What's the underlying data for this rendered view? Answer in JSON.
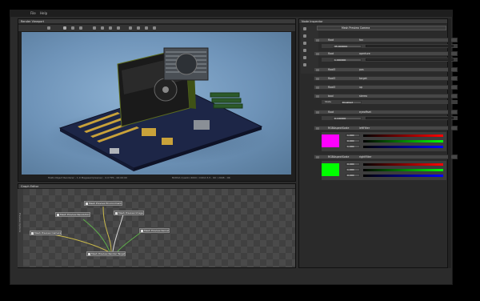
{
  "menu": {
    "file": "File",
    "help": "Help"
  },
  "viewport": {
    "title": "Render Viewport",
    "status_left": "Multi-Object Renderer  -  1.0  Megasamples/sec  -  0.0 FPS  -  00:00:00",
    "status_right": "NVIDIA Quadro 6000 / CUDA 5.5  -  60 / 2048  -  OK"
  },
  "inspector": {
    "title": "Node Inspector",
    "header_value": "Mesh Preview Camera",
    "rows": [
      {
        "type": "float",
        "name": "fov",
        "value": "35.000000"
      },
      {
        "type": "float",
        "name": "aperture",
        "value": "1.000000"
      },
      {
        "type": "float3",
        "name": "pos"
      },
      {
        "type": "float3",
        "name": "target"
      },
      {
        "type": "float3",
        "name": "up"
      },
      {
        "type": "bool",
        "name": "stereo",
        "state_label": "State",
        "state_value": "Disabled"
      },
      {
        "type": "float",
        "name": "eyeoffset",
        "value": "0.100000"
      }
    ],
    "colors": [
      {
        "type": "RGBAspectScale",
        "name": "leftFilter",
        "hex": "#ff00ff",
        "r": "1.000",
        "g": "0.000",
        "b": "1.000"
      },
      {
        "type": "RGBAspectScale",
        "name": "rightFilter",
        "hex": "#00ff00",
        "r": "0.000",
        "g": "1.000",
        "b": "0.000"
      }
    ]
  },
  "graph": {
    "title": "Graph Editor",
    "side_label": "Preview Options",
    "nodes": [
      {
        "id": "env",
        "label": "Mesh Preview Environment"
      },
      {
        "id": "mat",
        "label": "Mesh Preview Resolution"
      },
      {
        "id": "img",
        "label": "Mesh Preview Image"
      },
      {
        "id": "cam",
        "label": "Mesh Preview Camera"
      },
      {
        "id": "kern",
        "label": "Mesh Preview Kernel"
      },
      {
        "id": "target",
        "label": "Mesh Preview Render Target"
      }
    ]
  }
}
